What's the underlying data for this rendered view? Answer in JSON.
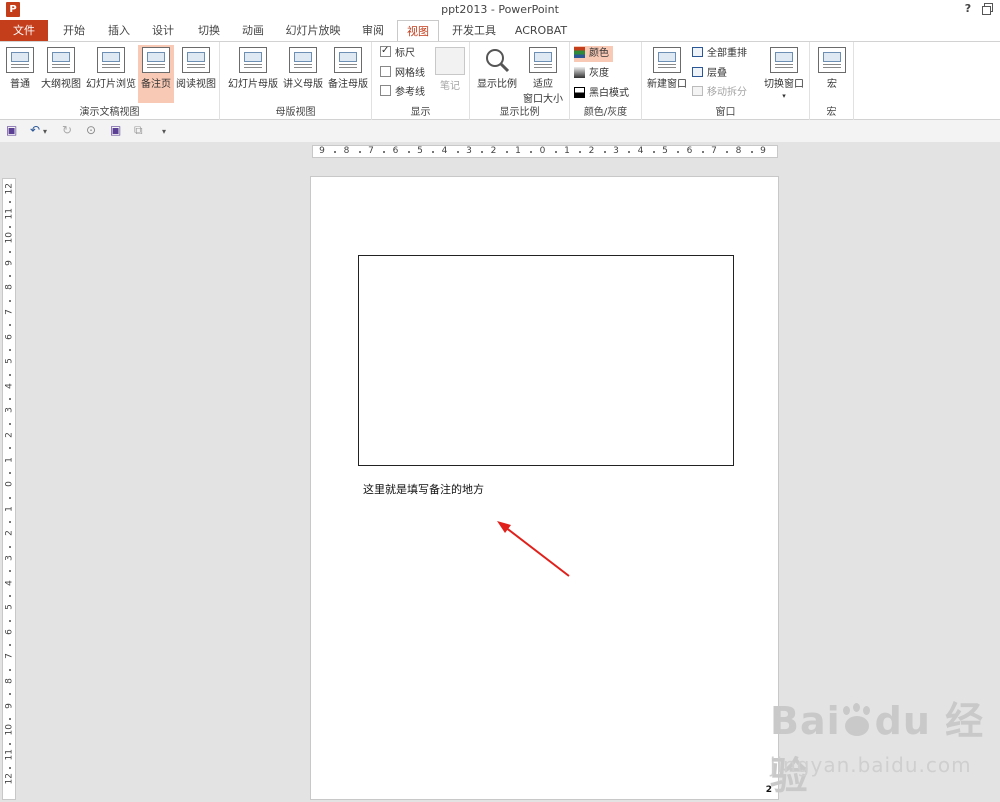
{
  "window": {
    "title": "ppt2013 - PowerPoint",
    "app_icon": "P",
    "help": "?"
  },
  "tabs": [
    {
      "label": "文件"
    },
    {
      "label": "开始"
    },
    {
      "label": "插入"
    },
    {
      "label": "设计"
    },
    {
      "label": "切换"
    },
    {
      "label": "动画"
    },
    {
      "label": "幻灯片放映"
    },
    {
      "label": "审阅"
    },
    {
      "label": "视图"
    },
    {
      "label": "开发工具"
    },
    {
      "label": "ACROBAT"
    }
  ],
  "active_tab": "视图",
  "ribbon": {
    "presentation_views": {
      "label": "演示文稿视图",
      "buttons": [
        "普通",
        "大纲视图",
        "幻灯片浏览",
        "备注页",
        "阅读视图"
      ],
      "selected": "备注页"
    },
    "master_views": {
      "label": "母版视图",
      "buttons": [
        "幻灯片母版",
        "讲义母版",
        "备注母版"
      ]
    },
    "show": {
      "label": "显示",
      "ruler": "标尺",
      "gridlines": "网格线",
      "guides": "参考线",
      "notes": "笔记",
      "ruler_checked": true
    },
    "zoom": {
      "label": "显示比例",
      "zoom_btn": "显示比例",
      "fit_btn_1": "适应",
      "fit_btn_2": "窗口大小"
    },
    "color_gray": {
      "label": "颜色/灰度",
      "color": "颜色",
      "grayscale": "灰度",
      "bw": "黑白模式",
      "selected": "颜色"
    },
    "window": {
      "label": "窗口",
      "new_window": "新建窗口",
      "arrange_all": "全部重排",
      "cascade": "层叠",
      "move_split": "移动拆分",
      "switch_windows": "切换窗口"
    },
    "macros": {
      "label": "宏",
      "button": "宏"
    }
  },
  "rulers": {
    "horizontal": [
      "9",
      "8",
      "7",
      "6",
      "5",
      "4",
      "3",
      "2",
      "1",
      "0",
      "1",
      "2",
      "3",
      "4",
      "5",
      "6",
      "7",
      "8",
      "9"
    ],
    "vertical": [
      "12",
      "11",
      "10",
      "9",
      "8",
      "7",
      "6",
      "5",
      "4",
      "3",
      "2",
      "1",
      "0",
      "1",
      "2",
      "3",
      "4",
      "5",
      "6",
      "7",
      "8",
      "9",
      "10",
      "11",
      "12"
    ]
  },
  "page": {
    "notes_text": "这里就是填写备注的地方",
    "page_number": "2"
  },
  "watermark": {
    "logo": "Bai du 经验",
    "url": "jingyan.baidu.com"
  },
  "colors": {
    "accent": "#c43e1c",
    "selected_bg": "#f8c9b5",
    "arrow": "#e0201a"
  }
}
